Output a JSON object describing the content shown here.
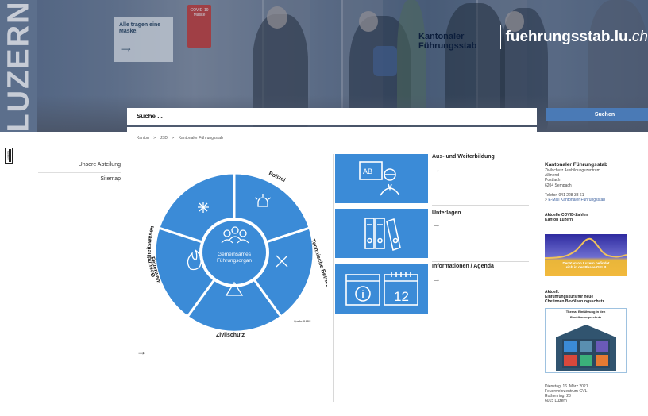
{
  "hero": {
    "canton_word": "LUZERN",
    "brand_name": "Kantonaler Führungsstab",
    "site_name_main": "fuehrungsstab.lu.",
    "site_name_tld": "ch",
    "poster_line1": "Alle tragen eine",
    "poster_line2": "Maske.",
    "red_sign_text": "COVID-19 Maske"
  },
  "search": {
    "placeholder": "Suche ...",
    "button_label": "Suchen"
  },
  "logo": {
    "text": "LUZERN"
  },
  "nav": {
    "items": [
      {
        "label": "Unsere Abteilung"
      },
      {
        "label": "Sitemap"
      }
    ]
  },
  "breadcrumb": {
    "items": [
      "Kanton",
      ">",
      "JSD",
      ">",
      "Kantonaler Führungsstab"
    ]
  },
  "wheel": {
    "center_line1": "Gemeinsames",
    "center_line2": "Führungsorgan",
    "segments": [
      "Gesundheitswesen",
      "Polizei",
      "Technische Betriebe",
      "Zivilschutz",
      "Feuerwehr"
    ],
    "source": "Quelle: BABS",
    "arrow": "→"
  },
  "cards": [
    {
      "title": "Aus- und Weiterbildung",
      "arrow": "→",
      "icon": "teacher-board-icon"
    },
    {
      "title": "Unterlagen",
      "arrow": "→",
      "icon": "binders-icon"
    },
    {
      "title": "Informationen / Agenda",
      "arrow": "→",
      "icon": "info-calendar-icon",
      "calendar_day": "12"
    }
  ],
  "aside": {
    "heading": "Kantonaler Führungsstab",
    "address": [
      "Zivilschutz Ausbildungszentrum",
      "Allmend",
      "Postfach",
      "6204 Sempach"
    ],
    "phone": "Telefon 041 228 38 61",
    "mail_prefix": "> ",
    "mail_link": "E-Mail Kantonaler Führungsstab",
    "covid_heading_1": "Aktuelle COVID-Zahlen",
    "covid_heading_2": "Kanton Luzern",
    "covid_banner_1": "Der Kanton Luzern befindet",
    "covid_banner_2": "sich in der Phase GELB",
    "news_label": "Aktuell:",
    "news_title_1": "Einführungskurs für neue",
    "news_title_2": "Chefinnen Bevölkerungsschutz",
    "image_caption_1": "Thema: Einführung in den",
    "image_caption_2": "Bevölkerungsschutz",
    "event_date": "Dienstag, 16. März 2021",
    "event_place": [
      "Feuerwehrzentrum GVL",
      "Rothenring, 23",
      "6015 Luzern"
    ]
  },
  "colors": {
    "accent": "#3b8bd7",
    "button": "#4a7ab6",
    "hero_overlay": "#5c6f8c"
  }
}
